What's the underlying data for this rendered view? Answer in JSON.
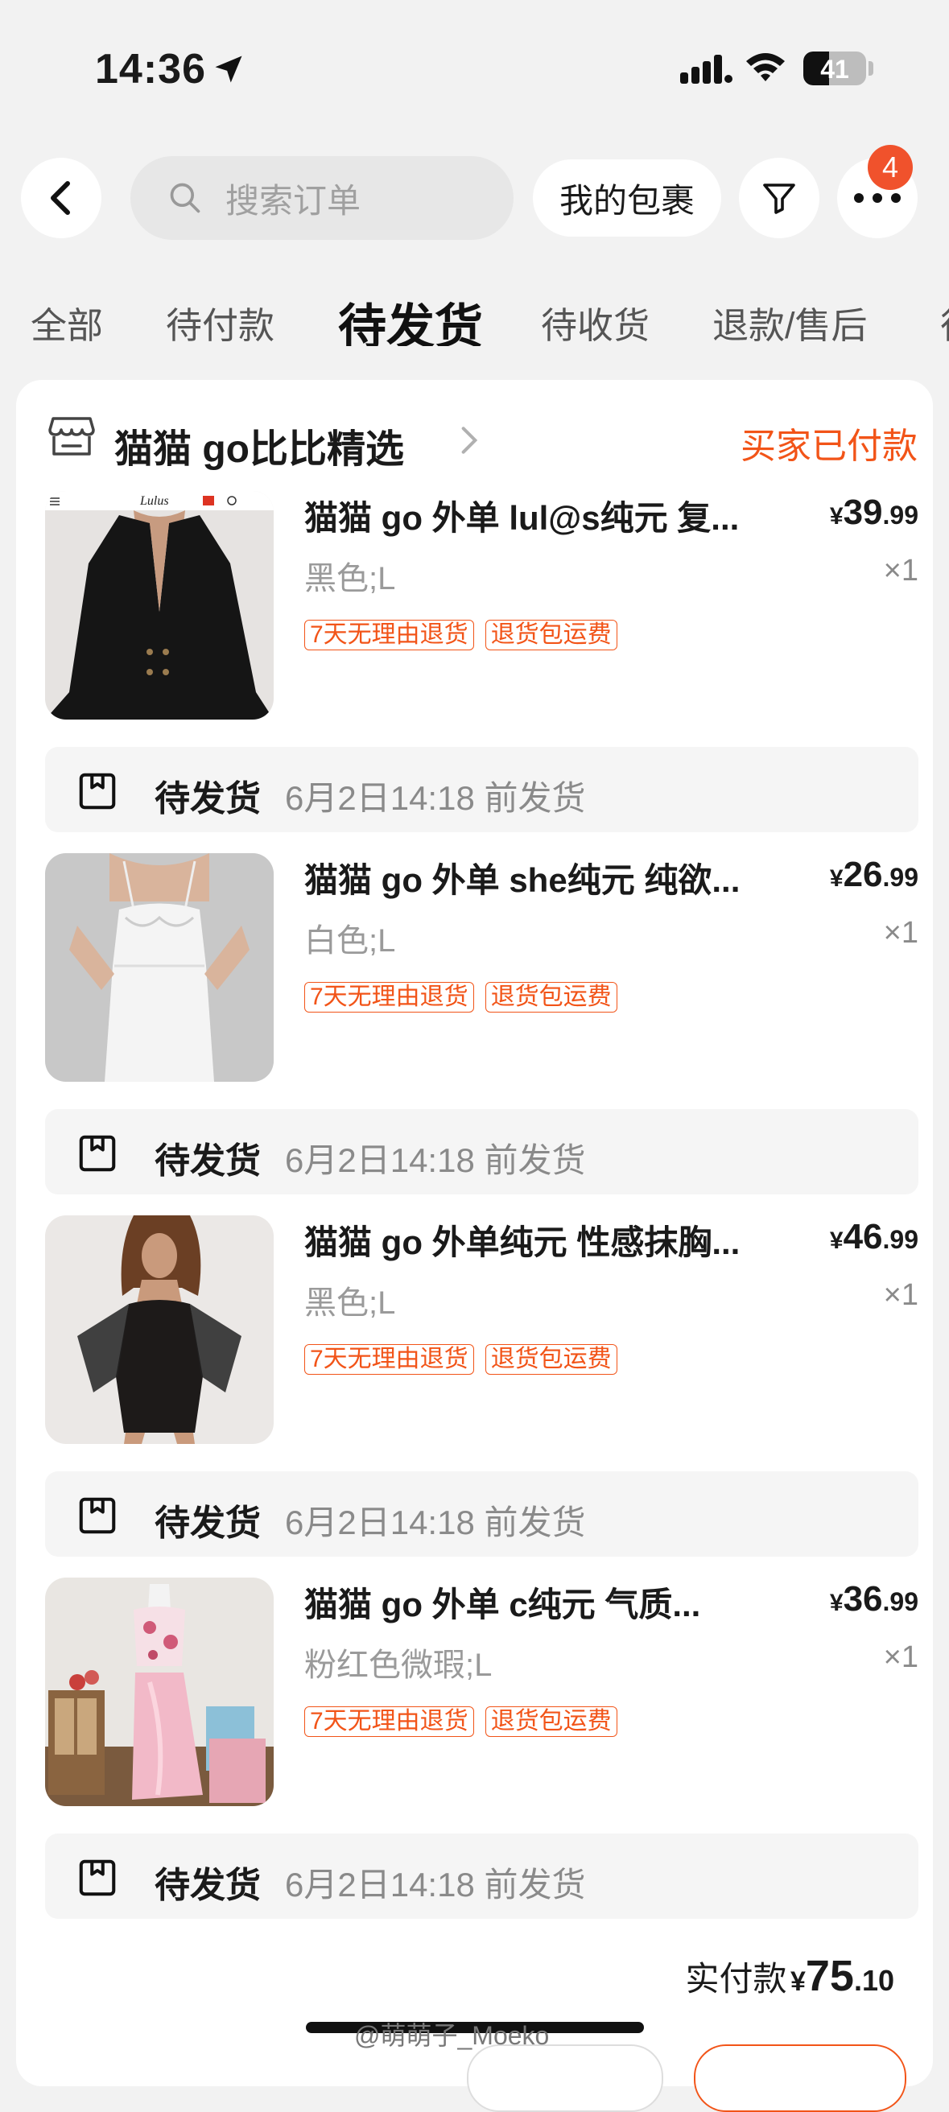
{
  "status_bar": {
    "time": "14:36",
    "battery": "41",
    "battery_level": 0.41
  },
  "search": {
    "placeholder": "搜索订单"
  },
  "header": {
    "packages_label": "我的包裹",
    "more_badge": "4"
  },
  "tabs": [
    {
      "label": "全部"
    },
    {
      "label": "待付款"
    },
    {
      "label": "待发货",
      "active": true
    },
    {
      "label": "待收货"
    },
    {
      "label": "退款/售后"
    },
    {
      "label": "待"
    }
  ],
  "order": {
    "shop_name": "猫猫 go比比精选",
    "status": "买家已付款",
    "items": [
      {
        "title": "猫猫 go 外单 lul@s纯元 复...",
        "price_symbol": "¥",
        "price_int": "39",
        "price_dec": ".99",
        "variant": "黑色;L",
        "qty": "×1",
        "tags": [
          "7天无理由退货",
          "退货包运费"
        ],
        "shipping_status": "待发货",
        "shipping_deadline": "6月2日14:18 前发货",
        "image": "black-corset-top-photo"
      },
      {
        "title": "猫猫 go 外单 she纯元  纯欲...",
        "price_symbol": "¥",
        "price_int": "26",
        "price_dec": ".99",
        "variant": "白色;L",
        "qty": "×1",
        "tags": [
          "7天无理由退货",
          "退货包运费"
        ],
        "shipping_status": "待发货",
        "shipping_deadline": "6月2日14:18 前发货",
        "image": "white-lace-dress-photo"
      },
      {
        "title": "猫猫 go 外单纯元 性感抹胸...",
        "price_symbol": "¥",
        "price_int": "46",
        "price_dec": ".99",
        "variant": "黑色;L",
        "qty": "×1",
        "tags": [
          "7天无理由退货",
          "退货包运费"
        ],
        "shipping_status": "待发货",
        "shipping_deadline": "6月2日14:18 前发货",
        "image": "black-mesh-dress-photo"
      },
      {
        "title": "猫猫 go 外单 c纯元 气质...",
        "price_symbol": "¥",
        "price_int": "36",
        "price_dec": ".99",
        "variant": "粉红色微瑕;L",
        "qty": "×1",
        "tags": [
          "7天无理由退货",
          "退货包运费"
        ],
        "shipping_status": "待发货",
        "shipping_deadline": "6月2日14:18 前发货",
        "image": "pink-satin-set-photo"
      }
    ],
    "total_label": "实付款",
    "total_symbol": "¥",
    "total_int": "75",
    "total_dec": ".10"
  },
  "watermark": "@萌萌子_Moeko",
  "colors": {
    "accent": "#f25418",
    "badge": "#f0522c",
    "background": "#f2f2f2"
  }
}
